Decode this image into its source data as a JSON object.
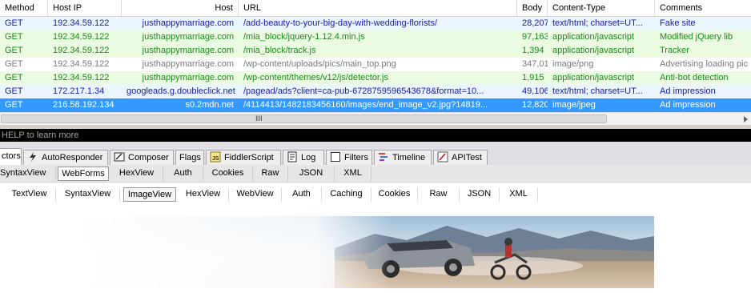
{
  "grid": {
    "headers": {
      "method": "Method",
      "host_ip": "Host IP",
      "host": "Host",
      "url": "URL",
      "body": "Body",
      "content_type": "Content-Type",
      "comments": "Comments"
    },
    "rows": [
      {
        "method": "GET",
        "host_ip": "192.34.59.122",
        "host": "justhappymarriage.com",
        "url": "/add-beauty-to-your-big-day-with-wedding-florists/",
        "body": "28,207",
        "content_type": "text/html; charset=UT...",
        "comments": "Fake site"
      },
      {
        "method": "GET",
        "host_ip": "192.34.59.122",
        "host": "justhappymarriage.com",
        "url": "/mia_block/jquery-1.12.4.min.js",
        "body": "97,163",
        "content_type": "application/javascript",
        "comments": "Modified jQuery lib"
      },
      {
        "method": "GET",
        "host_ip": "192.34.59.122",
        "host": "justhappymarriage.com",
        "url": "/mia_block/track.js",
        "body": "1,394",
        "content_type": "application/javascript",
        "comments": "Tracker"
      },
      {
        "method": "GET",
        "host_ip": "192.34.59.122",
        "host": "justhappymarriage.com",
        "url": "/wp-content/uploads/pics/main_top.png",
        "body": "347,011",
        "content_type": "image/png",
        "comments": "Advertising loading pic"
      },
      {
        "method": "GET",
        "host_ip": "192.34.59.122",
        "host": "justhappymarriage.com",
        "url": "/wp-content/themes/v12/js/detector.js",
        "body": "1,915",
        "content_type": "application/javascript",
        "comments": "Anti-bot detection"
      },
      {
        "method": "GET",
        "host_ip": "172.217.1.34",
        "host": "googleads.g.doubleclick.net",
        "url": "/pagead/ads?client=ca-pub-6728759596543678&format=10...",
        "body": "49,106",
        "content_type": "text/html; charset=UT...",
        "comments": "Ad impression"
      },
      {
        "method": "GET",
        "host_ip": "216.58.192.134",
        "host": "s0.2mdn.net",
        "url": "/4114413/1482183456160/images/end_image_v2.jpg?14819...",
        "body": "12,820",
        "content_type": "image/jpeg",
        "comments": "Ad impression"
      }
    ],
    "scroll_grip": "ⅡⅡ"
  },
  "quickexec": {
    "hint": "HELP to learn more"
  },
  "tabs": [
    {
      "label": "ctors"
    },
    {
      "label": "AutoResponder",
      "icon": "lightning-icon"
    },
    {
      "label": "Composer",
      "icon": "composer-icon"
    },
    {
      "label": "Flags"
    },
    {
      "label": "FiddlerScript",
      "icon": "js-icon"
    },
    {
      "label": "Log",
      "icon": "log-icon"
    },
    {
      "label": "Filters",
      "icon": "checkbox-icon"
    },
    {
      "label": "Timeline",
      "icon": "timeline-icon"
    },
    {
      "label": "APITest",
      "icon": "apitest-icon"
    }
  ],
  "request_views": [
    "SyntaxView",
    "WebForms",
    "HexView",
    "Auth",
    "Cookies",
    "Raw",
    "JSON",
    "XML"
  ],
  "response_views": [
    "TextView",
    "SyntaxView",
    "ImageView",
    "HexView",
    "WebView",
    "Auth",
    "Caching",
    "Cookies",
    "Raw",
    "JSON",
    "XML"
  ],
  "colors": {
    "selected": "#3399ff",
    "green_row": "#eafbe2",
    "blue_text": "#1a1aa6",
    "green_text": "#1a8a1a"
  }
}
